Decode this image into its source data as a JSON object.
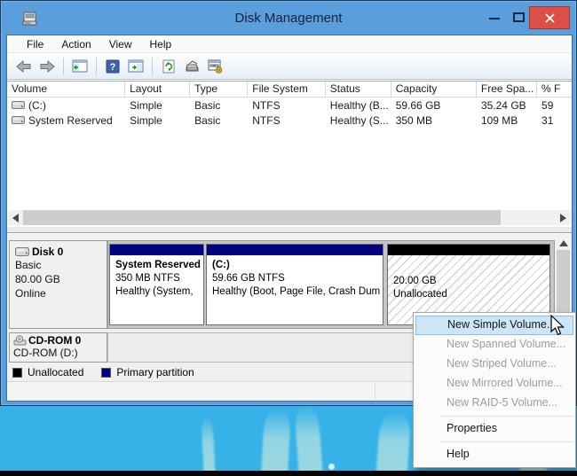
{
  "window": {
    "title": "Disk Management",
    "controls": {
      "minimize": "minimize",
      "maximize": "maximize",
      "close_glyph": "✕"
    }
  },
  "menu_bar": {
    "items": [
      "File",
      "Action",
      "View",
      "Help"
    ]
  },
  "toolbar": {
    "icons": [
      "back-icon",
      "forward-icon",
      "show-console-tree-icon",
      "help-icon",
      "show-action-pane-icon",
      "refresh-icon",
      "disk-properties-icon",
      "manage-computer-icon"
    ]
  },
  "volume_table": {
    "columns": [
      "Volume",
      "Layout",
      "Type",
      "File System",
      "Status",
      "Capacity",
      "Free Spa...",
      "% F"
    ],
    "rows": [
      [
        "(C:)",
        "Simple",
        "Basic",
        "NTFS",
        "Healthy (B...",
        "59.66 GB",
        "35.24 GB",
        "59"
      ],
      [
        "System Reserved",
        "Simple",
        "Basic",
        "NTFS",
        "Healthy (S...",
        "350 MB",
        "109 MB",
        "31"
      ]
    ]
  },
  "disk0": {
    "name": "Disk 0",
    "type": "Basic",
    "size": "80.00 GB",
    "status": "Online",
    "partitions": [
      {
        "name": "System Reserved",
        "size_fs": "350 MB NTFS",
        "status": "Healthy (System,"
      },
      {
        "name": "(C:)",
        "size_fs": "59.66 GB NTFS",
        "status": "Healthy (Boot, Page File, Crash Dum"
      },
      {
        "size": "20.00 GB",
        "label": "Unallocated"
      }
    ]
  },
  "cdrom": {
    "name": "CD-ROM 0",
    "drive": "CD-ROM (D:)"
  },
  "legend": {
    "items": [
      {
        "label": "Unallocated",
        "color": "#000000"
      },
      {
        "label": "Primary partition",
        "color": "#020283"
      }
    ]
  },
  "context_menu": {
    "items": [
      {
        "label": "New Simple Volume...",
        "state": "highlighted"
      },
      {
        "label": "New Spanned Volume...",
        "state": "disabled"
      },
      {
        "label": "New Striped Volume...",
        "state": "disabled"
      },
      {
        "label": "New Mirrored Volume...",
        "state": "disabled"
      },
      {
        "label": "New RAID-5 Volume...",
        "state": "disabled"
      },
      {
        "label": "Properties",
        "state": "normal"
      },
      {
        "label": "Help",
        "state": "normal"
      }
    ]
  },
  "colors": {
    "chrome_blue": "#5b9edc",
    "close_red": "#dd4f47",
    "primary_partition": "#020283",
    "unallocated": "#000000",
    "menu_highlight": "#cde6f7",
    "desktop_blue": "#36b2e9"
  }
}
